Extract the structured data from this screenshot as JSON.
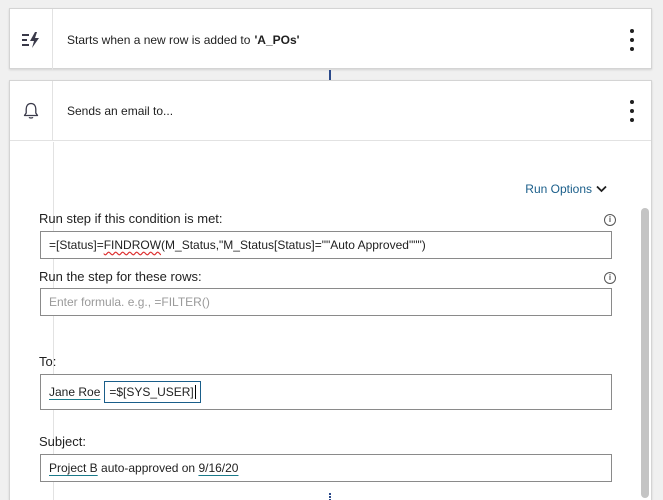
{
  "trigger": {
    "text": "Starts when a new row is added to",
    "table": "'A_POs'",
    "icon": "trigger-bolt-icon"
  },
  "action": {
    "title": "Sends an email to...",
    "icon": "bell-icon"
  },
  "run_options": {
    "label": "Run Options"
  },
  "condition": {
    "label": "Run step if this condition is met:",
    "value_prefix": "=[Status]=",
    "value_func": "FINDROW",
    "value_rest": "(M_Status,\"M_Status[Status]=\"\"Auto Approved\"\"\")"
  },
  "rows": {
    "label": "Run the step for these rows:",
    "placeholder": "Enter formula. e.g., =FILTER()"
  },
  "to": {
    "label": "To:",
    "recipient": "Jane Roe",
    "formula": "=$[SYS_USER]"
  },
  "subject": {
    "label": "Subject:",
    "part1": "Project B",
    "part2": " auto-approved on ",
    "part3": "9/16/20"
  },
  "colors": {
    "accent": "#1a5e8a",
    "connector": "#2b4a8a"
  }
}
